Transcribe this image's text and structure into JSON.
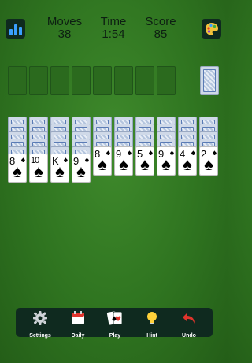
{
  "header": {
    "moves_label": "Moves",
    "moves_value": "38",
    "time_label": "Time",
    "time_value": "1:54",
    "score_label": "Score",
    "score_value": "85",
    "stats_icon": "bar-chart-icon",
    "theme_icon": "palette-icon"
  },
  "tableau": {
    "columns": [
      {
        "backs": 5,
        "top": {
          "rank": "8",
          "suit": "♠"
        }
      },
      {
        "backs": 5,
        "top": {
          "rank": "10",
          "suit": "♠"
        }
      },
      {
        "backs": 5,
        "top": {
          "rank": "K",
          "suit": "♠"
        }
      },
      {
        "backs": 5,
        "top": {
          "rank": "9",
          "suit": "♠"
        }
      },
      {
        "backs": 4,
        "top": {
          "rank": "8",
          "suit": "♠"
        }
      },
      {
        "backs": 4,
        "top": {
          "rank": "9",
          "suit": "♠"
        }
      },
      {
        "backs": 4,
        "top": {
          "rank": "5",
          "suit": "♠"
        }
      },
      {
        "backs": 4,
        "top": {
          "rank": "9",
          "suit": "♠"
        }
      },
      {
        "backs": 4,
        "top": {
          "rank": "4",
          "suit": "♠"
        }
      },
      {
        "backs": 4,
        "top": {
          "rank": "2",
          "suit": "♠"
        }
      }
    ]
  },
  "foundation_slots": 8,
  "toolbar": {
    "items": [
      {
        "label": "Settings",
        "icon": "gear-icon"
      },
      {
        "label": "Daily",
        "icon": "calendar-icon"
      },
      {
        "label": "Play",
        "icon": "cards-icon"
      },
      {
        "label": "Hint",
        "icon": "lightbulb-icon"
      },
      {
        "label": "Undo",
        "icon": "undo-arrow-icon"
      }
    ]
  },
  "colors": {
    "felt": "#2f7420",
    "toolbar_bg": "#0f2a1f",
    "card_back_accent": "#5a7bb5",
    "stats_icon": "#3aa0ff",
    "undo_icon": "#e0342c",
    "hint_icon": "#ffd23a"
  }
}
